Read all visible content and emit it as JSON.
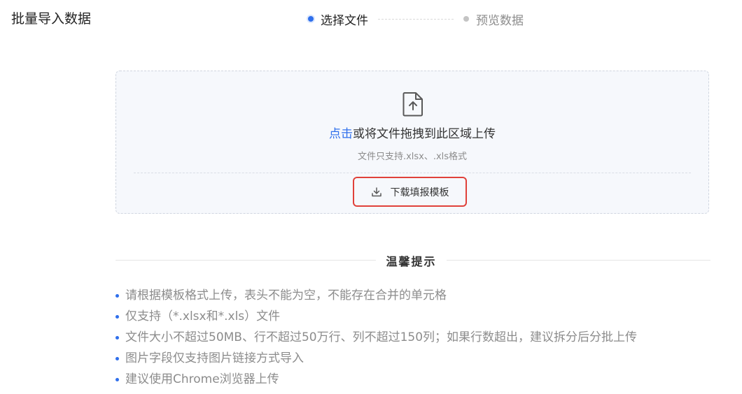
{
  "page": {
    "title": "批量导入数据"
  },
  "steps": [
    {
      "label": "选择文件",
      "state": "active"
    },
    {
      "label": "预览数据",
      "state": "pending"
    }
  ],
  "upload": {
    "link_text": "点击",
    "main_text": "或将文件拖拽到此区域上传",
    "sub_text": "文件只支持.xlsx、.xls格式",
    "icon": "file-upload-icon",
    "download_label": "下载填报模板",
    "download_icon": "download-icon"
  },
  "tips": {
    "title": "温馨提示",
    "items": [
      "请根据模板格式上传，表头不能为空，不能存在合并的单元格",
      "仅支持（*.xlsx和*.xls）文件",
      "文件大小不超过50MB、行不超过50万行、列不超过150列；如果行数超出，建议拆分后分批上传",
      "图片字段仅支持图片链接方式导入",
      "建议使用Chrome浏览器上传"
    ]
  },
  "colors": {
    "accent": "#2f6fec",
    "highlight_border": "#e0413a",
    "muted_text": "#8c8c8c",
    "upload_bg": "#f6f8fc"
  }
}
